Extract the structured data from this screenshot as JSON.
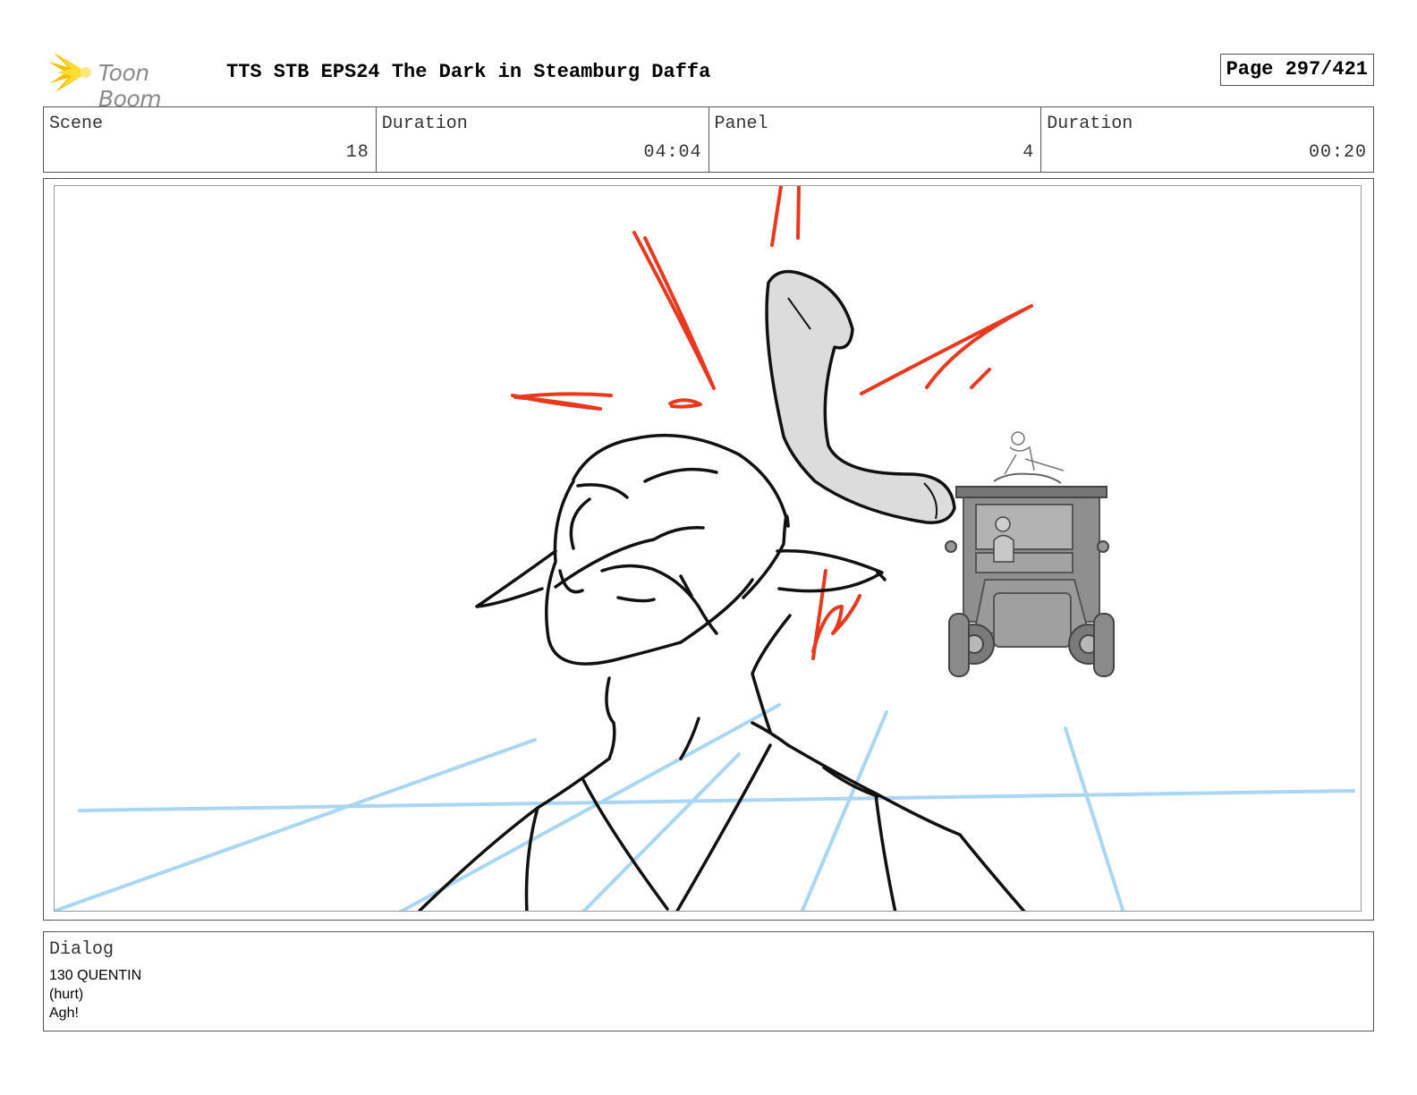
{
  "header": {
    "logo_text": "Toon Boom",
    "title": "TTS STB EPS24 The Dark in Steamburg Daffa",
    "page_label": "Page 297/421"
  },
  "info": {
    "scene_label": "Scene",
    "scene_value": "18",
    "scene_duration_label": "Duration",
    "scene_duration_value": "04:04",
    "panel_label": "Panel",
    "panel_value": "4",
    "panel_duration_label": "Duration",
    "panel_duration_value": "00:20"
  },
  "colors": {
    "sketch_line": "#111111",
    "impact_red": "#e8391f",
    "guide_blue": "#a9d6f2",
    "horn_fill": "#dcdcdc",
    "logo_yellow": "#f5c000"
  },
  "dialog": {
    "label": "Dialog",
    "lines": [
      "130 QUENTIN",
      "(hurt)",
      "Agh!"
    ]
  }
}
